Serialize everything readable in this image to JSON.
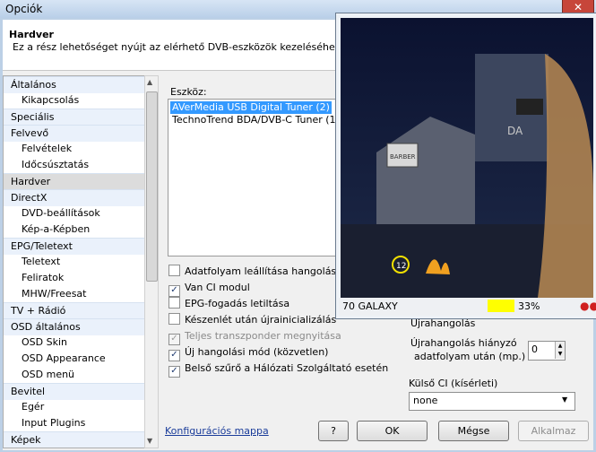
{
  "window": {
    "title": "Opciók",
    "close_label": "✕"
  },
  "header": {
    "title": "Hardver",
    "description": "Ez a rész lehetőséget nyújt az elérhető DVB-eszközök kezeléséhez."
  },
  "tree": [
    {
      "label": "Általános",
      "level": 0
    },
    {
      "label": "Kikapcsolás",
      "level": 1
    },
    {
      "label": "Speciális",
      "level": 0
    },
    {
      "label": "Felvevő",
      "level": 0
    },
    {
      "label": "Felvételek",
      "level": 1
    },
    {
      "label": "Időcsúsztatás",
      "level": 1
    },
    {
      "label": "Hardver",
      "level": 0,
      "selected": true
    },
    {
      "label": "DirectX",
      "level": 0
    },
    {
      "label": "DVD-beállítások",
      "level": 1
    },
    {
      "label": "Kép-a-Képben",
      "level": 1
    },
    {
      "label": "EPG/Teletext",
      "level": 0
    },
    {
      "label": "Teletext",
      "level": 1
    },
    {
      "label": "Feliratok",
      "level": 1
    },
    {
      "label": "MHW/Freesat",
      "level": 1
    },
    {
      "label": "TV + Rádió",
      "level": 0
    },
    {
      "label": "OSD általános",
      "level": 0
    },
    {
      "label": "OSD Skin",
      "level": 1
    },
    {
      "label": "OSD Appearance",
      "level": 1
    },
    {
      "label": "OSD menü",
      "level": 1
    },
    {
      "label": "Bevitel",
      "level": 0
    },
    {
      "label": "Egér",
      "level": 1
    },
    {
      "label": "Input Plugins",
      "level": 1
    },
    {
      "label": "Képek",
      "level": 0
    }
  ],
  "devices": {
    "label": "Eszköz:",
    "items": [
      "AVerMedia USB Digital Tuner (2)",
      "TechnoTrend BDA/DVB-C Tuner (1"
    ],
    "selected": 0
  },
  "options": [
    {
      "label": "Adatfolyam leállítása hangolás a",
      "checked": false,
      "disabled": false
    },
    {
      "label": "Van CI modul",
      "checked": true,
      "disabled": false
    },
    {
      "label": "EPG-fogadás letiltása",
      "checked": false,
      "disabled": false
    },
    {
      "label": "Készenlét után újrainicializálás",
      "checked": false,
      "disabled": false
    },
    {
      "label": "Teljes transzponder megnyitása",
      "checked": true,
      "disabled": true
    },
    {
      "label": "Új hangolási mód (közvetlen)",
      "checked": true,
      "disabled": false
    },
    {
      "label": "Belső szűrő a Hálózati Szolgáltató esetén",
      "checked": true,
      "disabled": false
    }
  ],
  "retune": {
    "heading": "Újrahangolás",
    "label_line1": "Újrahangolás hiányzó",
    "label_line2": "adatfolyam után (mp.)",
    "value": "0"
  },
  "external_ci": {
    "label": "Külső CI (kísérleti)",
    "value": "none"
  },
  "footer": {
    "config_link": "Konfigurációs mappa",
    "help_label": "?",
    "ok_label": "OK",
    "cancel_label": "Mégse",
    "apply_label": "Alkalmaz"
  },
  "video": {
    "channel_name": "70 GALAXY",
    "signal_percent": "33%",
    "signal_level": 33,
    "sign_text": "BARBER",
    "sign_text_2": "DA",
    "badge": "12"
  }
}
